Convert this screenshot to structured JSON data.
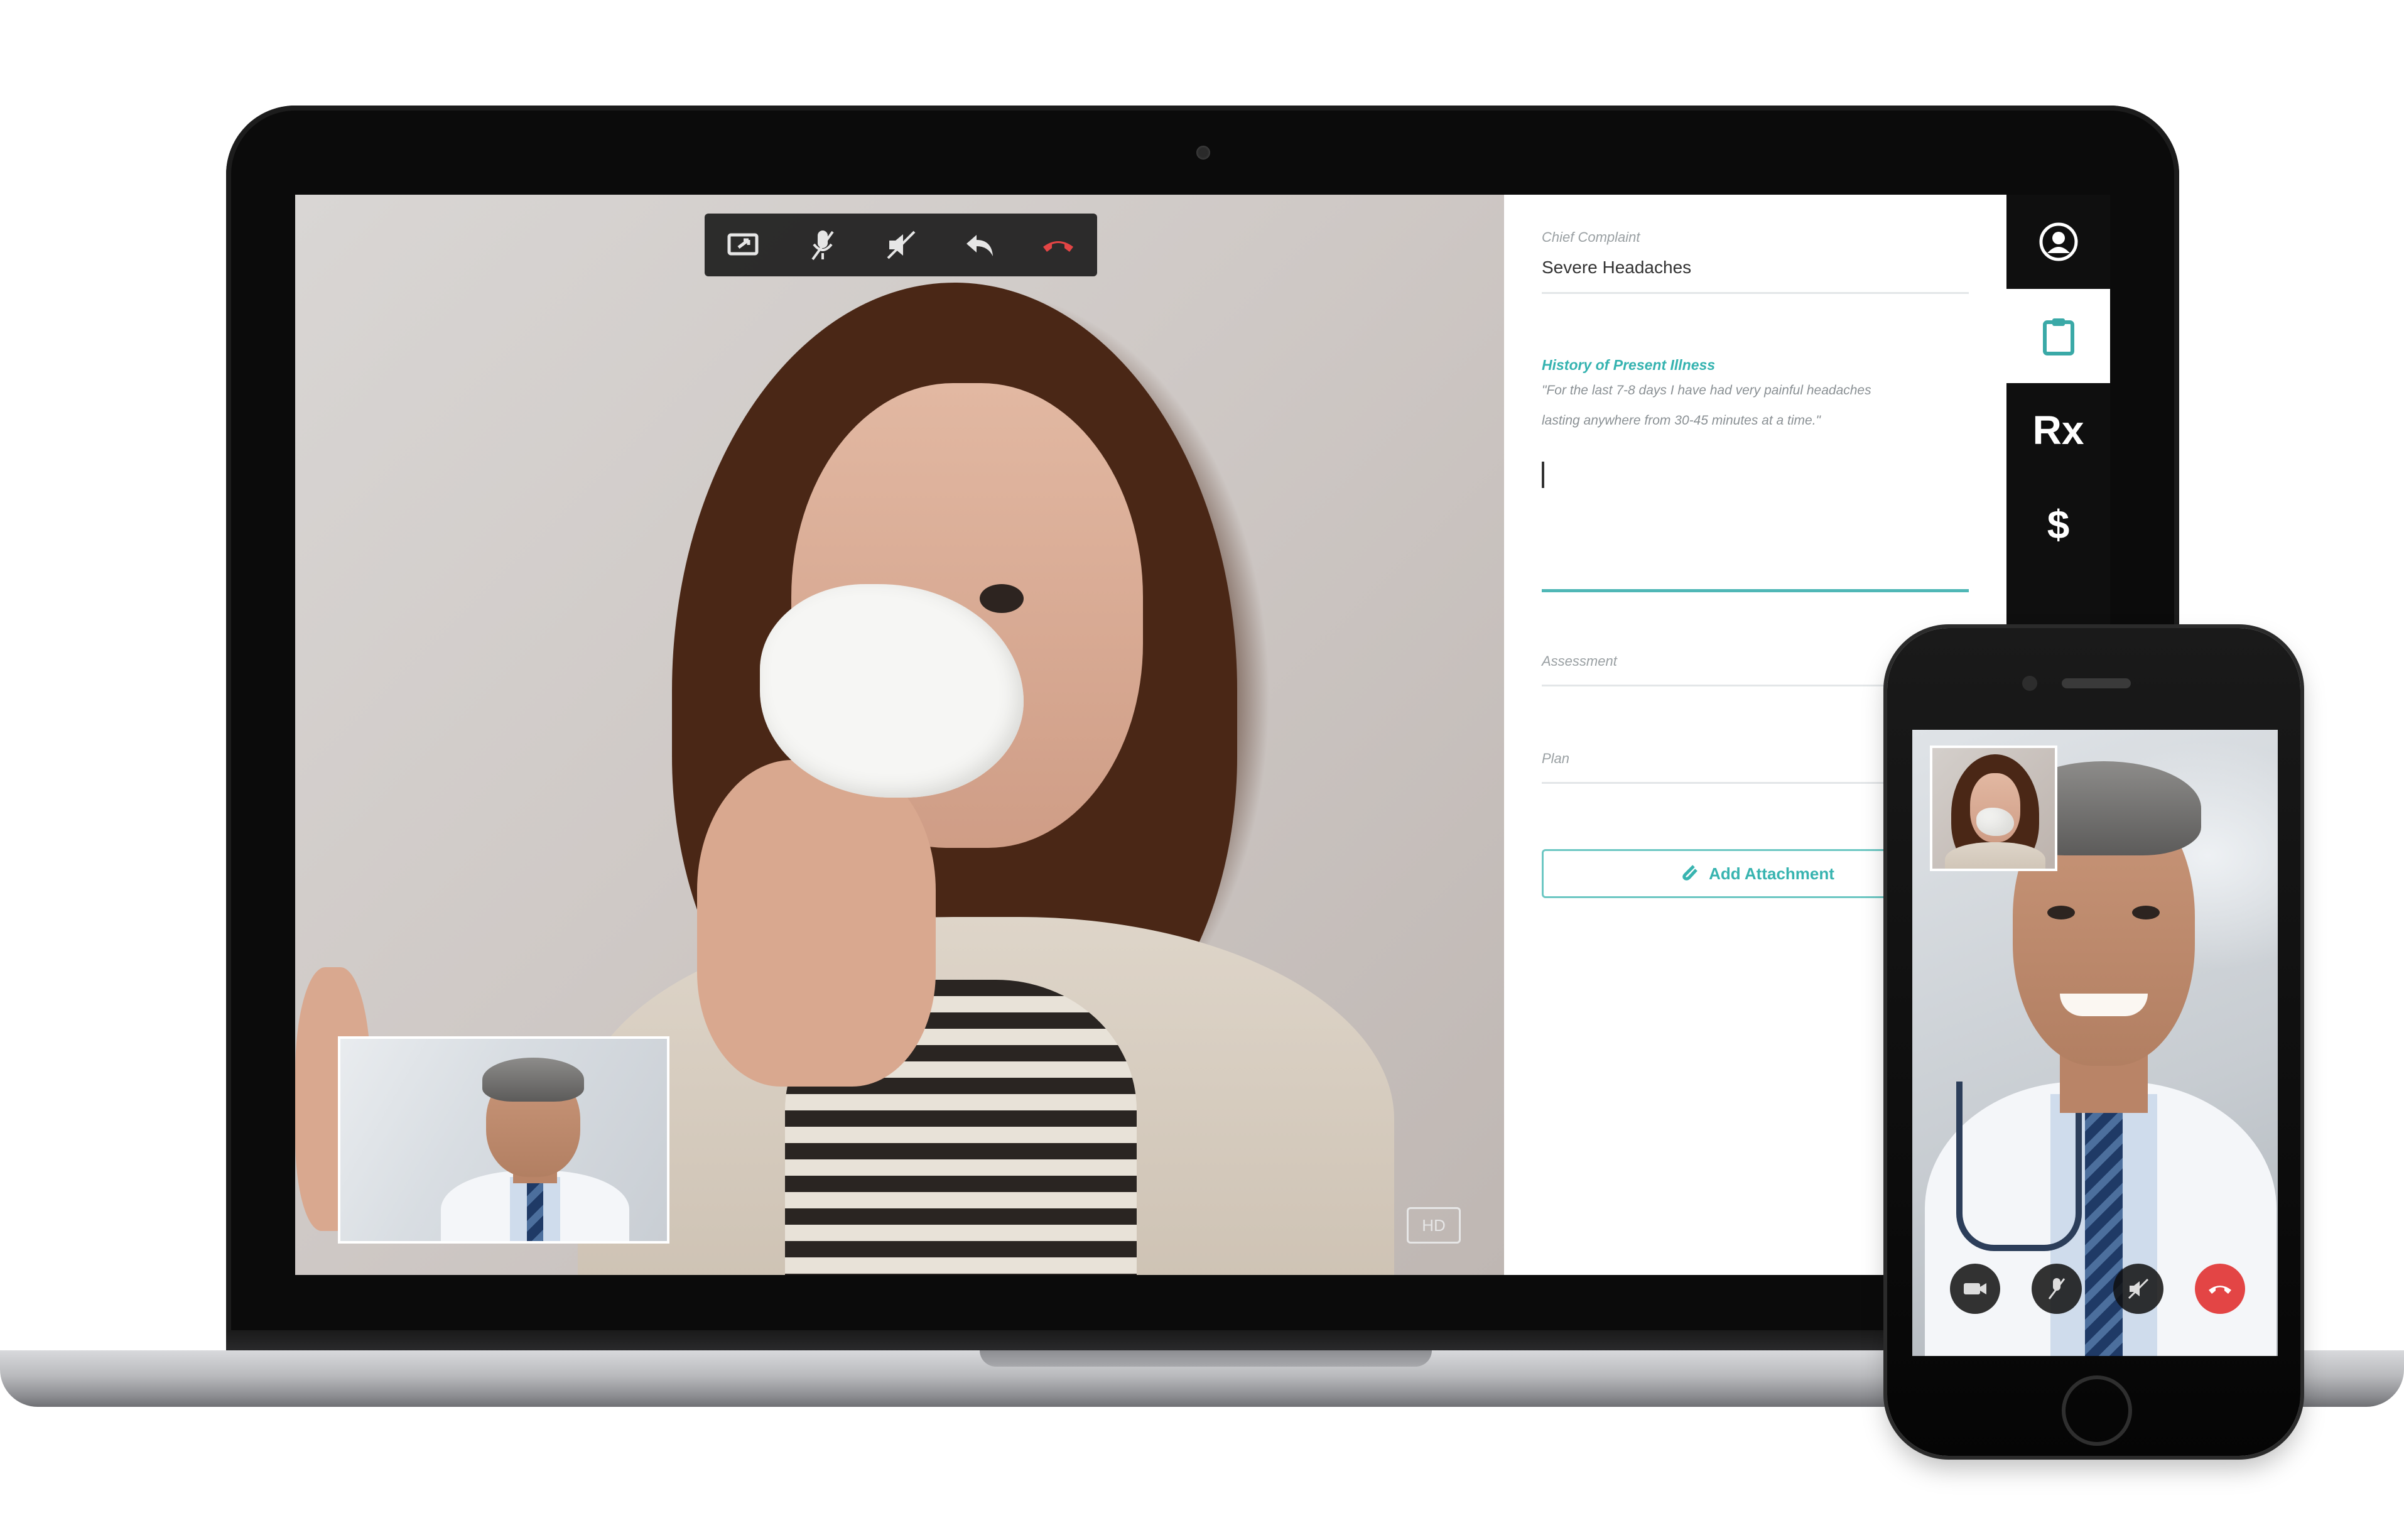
{
  "toolbar": {
    "buttons": [
      {
        "icon": "screen-share-icon"
      },
      {
        "icon": "mute-mic-icon"
      },
      {
        "icon": "mute-speaker-icon"
      },
      {
        "icon": "return-icon"
      },
      {
        "icon": "end-call-icon",
        "color": "#e34545"
      }
    ]
  },
  "video": {
    "hd_badge": "HD"
  },
  "notes": {
    "chief_complaint_label": "Chief Complaint",
    "chief_complaint_value": "Severe Headaches",
    "hpi_label": "History of Present Illness",
    "hpi_text_line1": "\"For the last 7-8 days I have had very painful headaches",
    "hpi_text_line2": "lasting anywhere from 30-45 minutes at a time.\"",
    "assessment_label": "Assessment",
    "plan_label": "Plan",
    "add_attachment_label": "Add Attachment",
    "accent_color": "#35b3b0"
  },
  "sidebar": {
    "items": [
      {
        "icon": "user-icon"
      },
      {
        "icon": "clipboard-icon",
        "active": true
      },
      {
        "icon": "prescription-icon",
        "label": "Rx"
      },
      {
        "icon": "billing-icon",
        "label": "$"
      }
    ]
  },
  "phone": {
    "buttons": [
      {
        "icon": "video-icon"
      },
      {
        "icon": "mute-mic-icon"
      },
      {
        "icon": "mute-speaker-icon"
      },
      {
        "icon": "end-call-icon",
        "color": "#e34545"
      }
    ]
  }
}
